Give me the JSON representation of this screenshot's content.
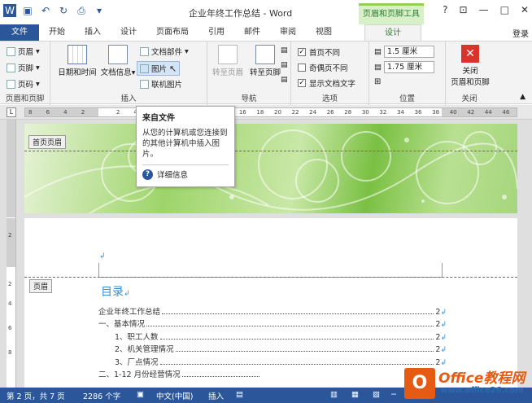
{
  "window": {
    "title": "企业年终工作总结 - Word",
    "context_tab_title": "页眉和页脚工具",
    "controls": [
      "?",
      "⊡",
      "—",
      "□",
      "✕"
    ]
  },
  "tabs": {
    "items": [
      "文件",
      "开始",
      "插入",
      "设计",
      "页面布局",
      "引用",
      "邮件",
      "审阅",
      "视图"
    ],
    "active_context": "设计",
    "login": "登录"
  },
  "ribbon": {
    "group1": {
      "label": "页眉和页脚",
      "buttons": [
        "页眉",
        "页脚",
        "页码"
      ]
    },
    "group2": {
      "label": "插入",
      "date_time": "日期和时间",
      "doc_info": "文档信息",
      "doc_parts": "文档部件",
      "picture": "图片",
      "online_picture": "联机图片"
    },
    "group3": {
      "label": "导航",
      "goto_header": "转至页眉",
      "goto_footer": "转至页脚"
    },
    "group4": {
      "label": "选项",
      "first_page_diff": "首页不同",
      "odd_even_diff": "奇偶页不同",
      "show_doc_text": "显示文档文字"
    },
    "group5": {
      "label": "位置",
      "header_pos": "1.5 厘米",
      "footer_pos": "1.75 厘米"
    },
    "group6": {
      "label": "关闭",
      "close_btn_line1": "关闭",
      "close_btn_line2": "页眉和页脚"
    }
  },
  "tooltip": {
    "title": "来自文件",
    "body": "从您的计算机或您连接到的其他计算机中插入图片。",
    "more": "详细信息"
  },
  "ruler": {
    "numbers": [
      "8",
      "6",
      "4",
      "2",
      "",
      "2",
      "4",
      "",
      "",
      "",
      "",
      "",
      "16",
      "18",
      "20",
      "22",
      "24",
      "26",
      "28",
      "30",
      "32",
      "34",
      "36",
      "38",
      "40",
      "42",
      "44",
      "46"
    ],
    "vertical": [
      "2",
      "2",
      "4",
      "6",
      "8"
    ]
  },
  "document": {
    "first_page_header_tag": "首页页眉",
    "header_tag": "页眉",
    "toc_title": "目录",
    "toc": [
      {
        "text": "企业年终工作总结",
        "page": "2"
      },
      {
        "text": "一、基本情况",
        "page": "2"
      },
      {
        "text": "1、职工人数",
        "page": "2"
      },
      {
        "text": "2、机关管理情况",
        "page": "2"
      },
      {
        "text": "3、厂点情况",
        "page": "2"
      },
      {
        "text": "二、1-12 月份经营情况",
        "page": ""
      }
    ]
  },
  "statusbar": {
    "page": "第 2 页，共 7 页",
    "words": "2286 个字",
    "language": "中文(中国)",
    "mode": "插入"
  },
  "watermark": {
    "brand": "Office教程网",
    "url": "www.office26.com"
  },
  "colors": {
    "word_blue": "#2b579a",
    "context_green": "#92d050",
    "close_red": "#d9342b"
  }
}
